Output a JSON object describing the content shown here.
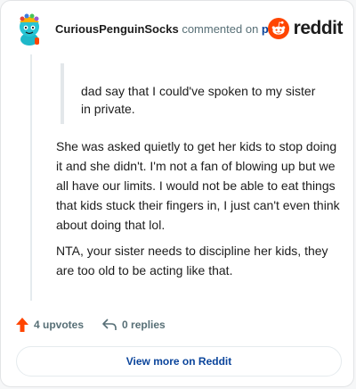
{
  "comment": {
    "username": "CuriousPenguinSocks",
    "action_text": " commented on ",
    "post_link": "post",
    "quote": "dad say that I could've spoken to my sister in private.",
    "paragraphs": [
      "She was asked quietly to get her kids to stop doing it and she didn't. I'm not a fan of blowing up but we all have our limits. I would not be able to eat things that kids stuck their fingers in, I just can't even think about doing that lol.",
      "NTA, your sister needs to discipline her kids, they are too old to be acting like that."
    ],
    "upvotes": "4 upvotes",
    "replies": "0 replies"
  },
  "brand": {
    "name": "reddit",
    "color": "#ff4500"
  },
  "view_more": "View more on Reddit",
  "icons": {
    "avatar": "snoo-avatar-icon",
    "logo": "reddit-logo-icon",
    "upvote": "upvote-arrow-icon",
    "reply": "reply-arrow-icon"
  }
}
